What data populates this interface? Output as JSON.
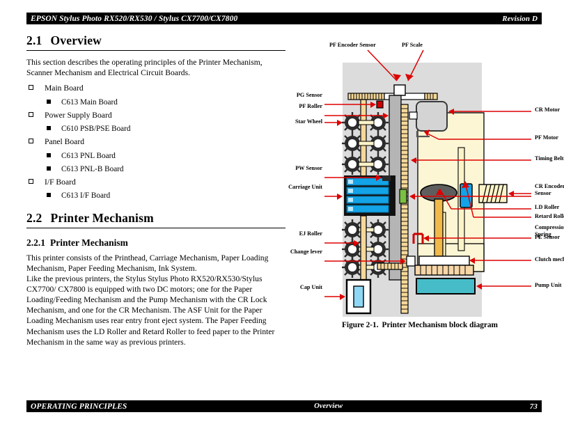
{
  "header": {
    "left": "EPSON Stylus Photo RX520/RX530 / Stylus CX7700/CX7800",
    "right": "Revision D"
  },
  "footer": {
    "left": "OPERATING PRINCIPLES",
    "center": "Overview",
    "right": "73"
  },
  "overview": {
    "number": "2.1",
    "title": "Overview",
    "intro": "This section describes the operating principles of the Printer Mechanism, Scanner Mechanism and Electrical Circuit Boards.",
    "boards": [
      {
        "label": "Main Board",
        "children": [
          "C613 Main Board"
        ]
      },
      {
        "label": "Power Supply Board",
        "children": [
          "C610 PSB/PSE Board"
        ]
      },
      {
        "label": "Panel Board",
        "children": [
          "C613 PNL Board",
          "C613 PNL-B Board"
        ]
      },
      {
        "label": "I/F Board",
        "children": [
          "C613 I/F Board"
        ]
      }
    ]
  },
  "printer_mechanism": {
    "number": "2.2",
    "title": "Printer Mechanism",
    "sub_number": "2.2.1",
    "sub_title": "Printer Mechanism",
    "paragraph1": "This printer consists of the Printhead, Carriage Mechanism, Paper Loading Mechanism, Paper Feeding Mechanism, Ink System.",
    "paragraph2": "Like the previous printers, the Stylus Stylus Photo RX520/RX530/Stylus CX7700/ CX7800 is equipped with two DC motors; one for the Paper Loading/Feeding Mechanism and the Pump Mechanism with the CR Lock Mechanism, and one for the CR Mechanism. The ASF Unit for the Paper Loading Mechanism uses rear entry front eject system. The Paper Feeding Mechanism uses the LD Roller and Retard Roller to feed paper to the Printer Mechanism in the same way as previous printers."
  },
  "figure": {
    "number": "Figure 2-1.",
    "caption": "Printer Mechanism block diagram",
    "colors": {
      "background": "#dcdcdc",
      "frame_cream": "#fdf6d5",
      "roller_tan": "#f5d89a",
      "carriage_blue": "#13a4e8",
      "pump_teal": "#45bcc8",
      "callout_red": "#dd0000",
      "motor_gray": "#d4d4d4",
      "encoder_green": "#7ac043",
      "pw_sensor_red": "#cc0000",
      "stopper_dark": "#3a3a3a"
    },
    "labels_left": [
      "PF Encoder Sensor",
      "PF Scale",
      "PG Sensor",
      "PF Roller",
      "Star Wheel",
      "PW Sensor",
      "Carriage Unit",
      "EJ Roller",
      "Change lever",
      "Cap Unit"
    ],
    "labels_right": [
      "CR Motor",
      "PF Motor",
      "Timing Belt",
      "CR Encoder Sensor",
      "LD Roller",
      "Retard Roller",
      "Compression Spring",
      "PE Sensor",
      "Clutch mechanism",
      "Pump Unit"
    ],
    "callouts": {
      "pf_encoder_sensor": "PF Encoder Sensor",
      "pf_scale": "PF Scale",
      "pg_sensor": "PG Sensor",
      "pf_roller": "PF Roller",
      "star_wheel": "Star Wheel",
      "pw_sensor": "PW Sensor",
      "carriage_unit": "Carriage Unit",
      "ej_roller": "EJ Roller",
      "change_lever": "Change lever",
      "cap_unit": "Cap Unit",
      "cr_motor": "CR Motor",
      "pf_motor": "PF Motor",
      "timing_belt": "Timing Belt",
      "cr_encoder_sensor_line1": "CR Encoder",
      "cr_encoder_sensor_line2": "Sensor",
      "ld_roller": "LD Roller",
      "retard_roller": "Retard Roller",
      "compression_spring_line1": "Compression",
      "compression_spring_line2": "Spring",
      "pe_sensor": "PE Sensor",
      "clutch_mechanism": "Clutch mechanism",
      "pump_unit": "Pump Unit"
    }
  }
}
